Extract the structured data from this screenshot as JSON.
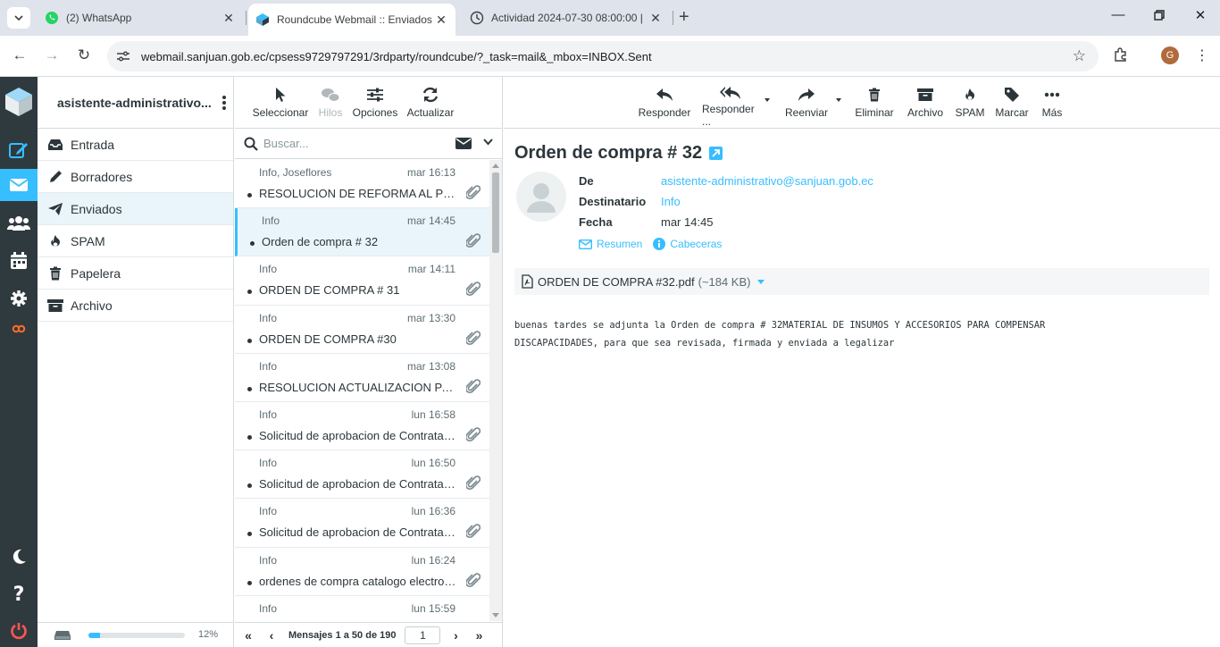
{
  "browser": {
    "tabs": [
      {
        "title": "(2) WhatsApp",
        "active": false
      },
      {
        "title": "Roundcube Webmail :: Enviados",
        "active": true
      },
      {
        "title": "Actividad 2024-07-30 08:00:00 |",
        "active": false
      }
    ],
    "url": "webmail.sanjuan.gob.ec/cpsess9729797291/3rdparty/roundcube/?_task=mail&_mbox=INBOX.Sent",
    "profile_initial": "G"
  },
  "account": {
    "name": "asistente-administrativo..."
  },
  "folders": [
    {
      "label": "Entrada",
      "icon": "inbox-icon",
      "selected": false
    },
    {
      "label": "Borradores",
      "icon": "pencil-icon",
      "selected": false
    },
    {
      "label": "Enviados",
      "icon": "paper-plane-icon",
      "selected": true
    },
    {
      "label": "SPAM",
      "icon": "fire-icon",
      "selected": false
    },
    {
      "label": "Papelera",
      "icon": "trash-icon",
      "selected": false
    },
    {
      "label": "Archivo",
      "icon": "archive-icon",
      "selected": false
    }
  ],
  "quota": {
    "percent": 12,
    "label": "12%"
  },
  "list_toolbar": [
    {
      "label": "Seleccionar",
      "icon": "cursor-icon",
      "disabled": false
    },
    {
      "label": "Hilos",
      "icon": "threads-icon",
      "disabled": true
    },
    {
      "label": "Opciones",
      "icon": "sliders-icon",
      "disabled": false
    },
    {
      "label": "Actualizar",
      "icon": "refresh-icon",
      "disabled": false
    }
  ],
  "search": {
    "placeholder": "Buscar..."
  },
  "messages": [
    {
      "from": "Info, Joseflores",
      "date": "mar 16:13",
      "subject": "RESOLUCION DE REFORMA AL PRESUPUESTO",
      "selected": false
    },
    {
      "from": "Info",
      "date": "mar 14:45",
      "subject": "Orden de compra # 32",
      "selected": true
    },
    {
      "from": "Info",
      "date": "mar 14:11",
      "subject": "ORDEN DE COMPRA # 31",
      "selected": false
    },
    {
      "from": "Info",
      "date": "mar 13:30",
      "subject": "ORDEN DE COMPRA #30",
      "selected": false
    },
    {
      "from": "Info",
      "date": "mar 13:08",
      "subject": "RESOLUCION ACTUALIZACION PAC",
      "selected": false
    },
    {
      "from": "Info",
      "date": "lun 16:58",
      "subject": "Solicitud de aprobacion de Contratacion",
      "selected": false
    },
    {
      "from": "Info",
      "date": "lun 16:50",
      "subject": "Solicitud de aprobacion de Contratacion",
      "selected": false
    },
    {
      "from": "Info",
      "date": "lun 16:36",
      "subject": "Solicitud de aprobacion de Contratacion",
      "selected": false
    },
    {
      "from": "Info",
      "date": "lun 16:24",
      "subject": "ordenes de compra catalogo electronico",
      "selected": false
    },
    {
      "from": "Info",
      "date": "lun 15:59",
      "subject": "",
      "selected": false
    }
  ],
  "pagination": {
    "text": "Mensajes 1 a 50 de 190",
    "page": "1"
  },
  "preview_toolbar": [
    {
      "label": "Responder",
      "icon": "reply-icon",
      "caret": false
    },
    {
      "label": "Responder ...",
      "icon": "reply-all-icon",
      "caret": true
    },
    {
      "label": "Reenviar",
      "icon": "forward-icon",
      "caret": true
    },
    {
      "label": "Eliminar",
      "icon": "trash-icon",
      "caret": false
    },
    {
      "label": "Archivo",
      "icon": "archive-icon",
      "caret": false
    },
    {
      "label": "SPAM",
      "icon": "fire-icon",
      "caret": false
    },
    {
      "label": "Marcar",
      "icon": "tag-icon",
      "caret": false
    },
    {
      "label": "Más",
      "icon": "more-icon",
      "caret": false
    }
  ],
  "message": {
    "subject": "Orden de compra # 32",
    "from_label": "De",
    "from": "asistente-administrativo@sanjuan.gob.ec",
    "to_label": "Destinatario",
    "to": "Info",
    "date_label": "Fecha",
    "date": "mar 14:45",
    "summary_link": "Resumen",
    "headers_link": "Cabeceras",
    "attachment_name": "ORDEN DE COMPRA #32.pdf",
    "attachment_size": "(~184 KB)",
    "body": "buenas tardes se adjunta la Orden de compra # 32MATERIAL DE INSUMOS Y ACCESORIOS PARA COMPENSAR\nDISCAPACIDADES, para que sea revisada, firmada y enviada a legalizar"
  },
  "colors": {
    "accent": "#37beff",
    "sidebar": "#2f3a3f",
    "danger": "#ff5552"
  }
}
